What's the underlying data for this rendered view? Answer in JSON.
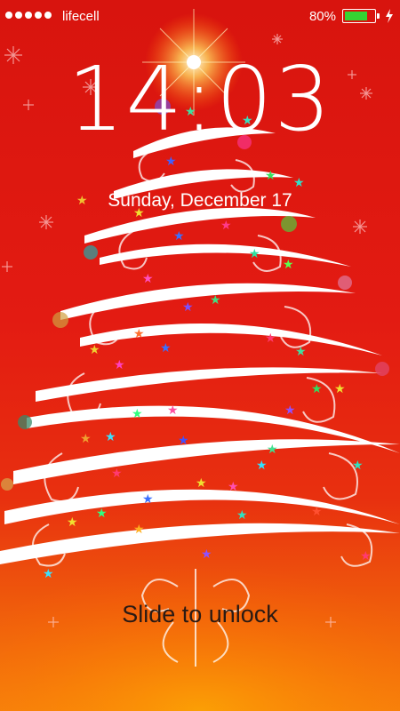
{
  "status_bar": {
    "signal_bars": 5,
    "carrier": "lifecell",
    "battery_percent_label": "80%",
    "battery_level": 0.8,
    "charging": true,
    "battery_color": "#35d332"
  },
  "lock_screen": {
    "time": "14:03",
    "date": "Sunday, December 17",
    "unlock_prompt": "Slide to unlock"
  },
  "wallpaper": {
    "subject": "christmas-tree",
    "colors": {
      "background_top": "#d8140e",
      "background_bottom": "#f6810c",
      "tree": "#ffffff",
      "star_glow": "#fff3a0"
    }
  }
}
